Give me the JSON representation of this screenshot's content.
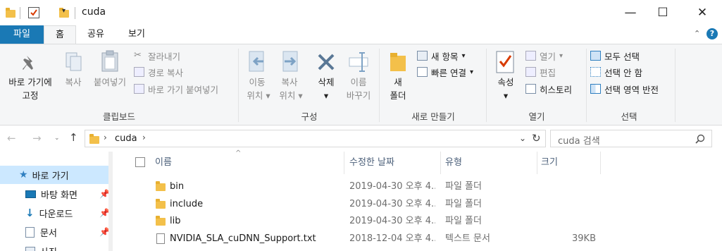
{
  "window": {
    "title": "cuda",
    "minimize_glyph": "—",
    "maximize_glyph": "☐",
    "close_glyph": "✕"
  },
  "ribbon_tabs": [
    "파일",
    "홈",
    "공유",
    "보기"
  ],
  "ribbon": {
    "clipboard": {
      "pin_label_1": "바로 가기에",
      "pin_label_2": "고정",
      "copy": "복사",
      "paste": "붙여넣기",
      "cut": "잘라내기",
      "copy_path": "경로 복사",
      "paste_shortcut": "바로 가기 붙여넣기",
      "group": "클립보드"
    },
    "organize": {
      "move_1": "이동",
      "move_2": "위치",
      "copyto_1": "복사",
      "copyto_2": "위치",
      "delete_1": "삭제",
      "rename_1": "이름",
      "rename_2": "바꾸기",
      "group": "구성"
    },
    "new": {
      "new_folder_1": "새",
      "new_folder_2": "폴더",
      "new_item": "새 항목",
      "easy_access": "빠른 연결",
      "group": "새로 만들기"
    },
    "open": {
      "properties": "속성",
      "open": "열기",
      "edit": "편집",
      "history": "히스토리",
      "group": "열기"
    },
    "select": {
      "select_all": "모두 선택",
      "select_none": "선택 안 함",
      "invert": "선택 영역 반전",
      "group": "선택"
    }
  },
  "address": {
    "path_item": "cuda",
    "search_placeholder": "cuda 검색"
  },
  "nav": {
    "items": [
      {
        "label": "바로 가기"
      },
      {
        "label": "바탕 화면"
      },
      {
        "label": "다운로드"
      },
      {
        "label": "문서"
      },
      {
        "label": "사진"
      }
    ]
  },
  "columns": {
    "name": "이름",
    "modified": "수정한 날짜",
    "type": "유형",
    "size": "크기"
  },
  "files": [
    {
      "name": "bin",
      "modified": "2019-04-30 오후 4...",
      "type": "파일 폴더",
      "size": "",
      "kind": "folder"
    },
    {
      "name": "include",
      "modified": "2019-04-30 오후 4...",
      "type": "파일 폴더",
      "size": "",
      "kind": "folder"
    },
    {
      "name": "lib",
      "modified": "2019-04-30 오후 4...",
      "type": "파일 폴더",
      "size": "",
      "kind": "folder"
    },
    {
      "name": "NVIDIA_SLA_cuDNN_Support.txt",
      "modified": "2018-12-04 오후 4...",
      "type": "텍스트 문서",
      "size": "39KB",
      "kind": "text"
    }
  ],
  "colors": {
    "accent": "#1a79b5",
    "folder": "#f3c04a",
    "nav_selected": "#cce8ff"
  }
}
